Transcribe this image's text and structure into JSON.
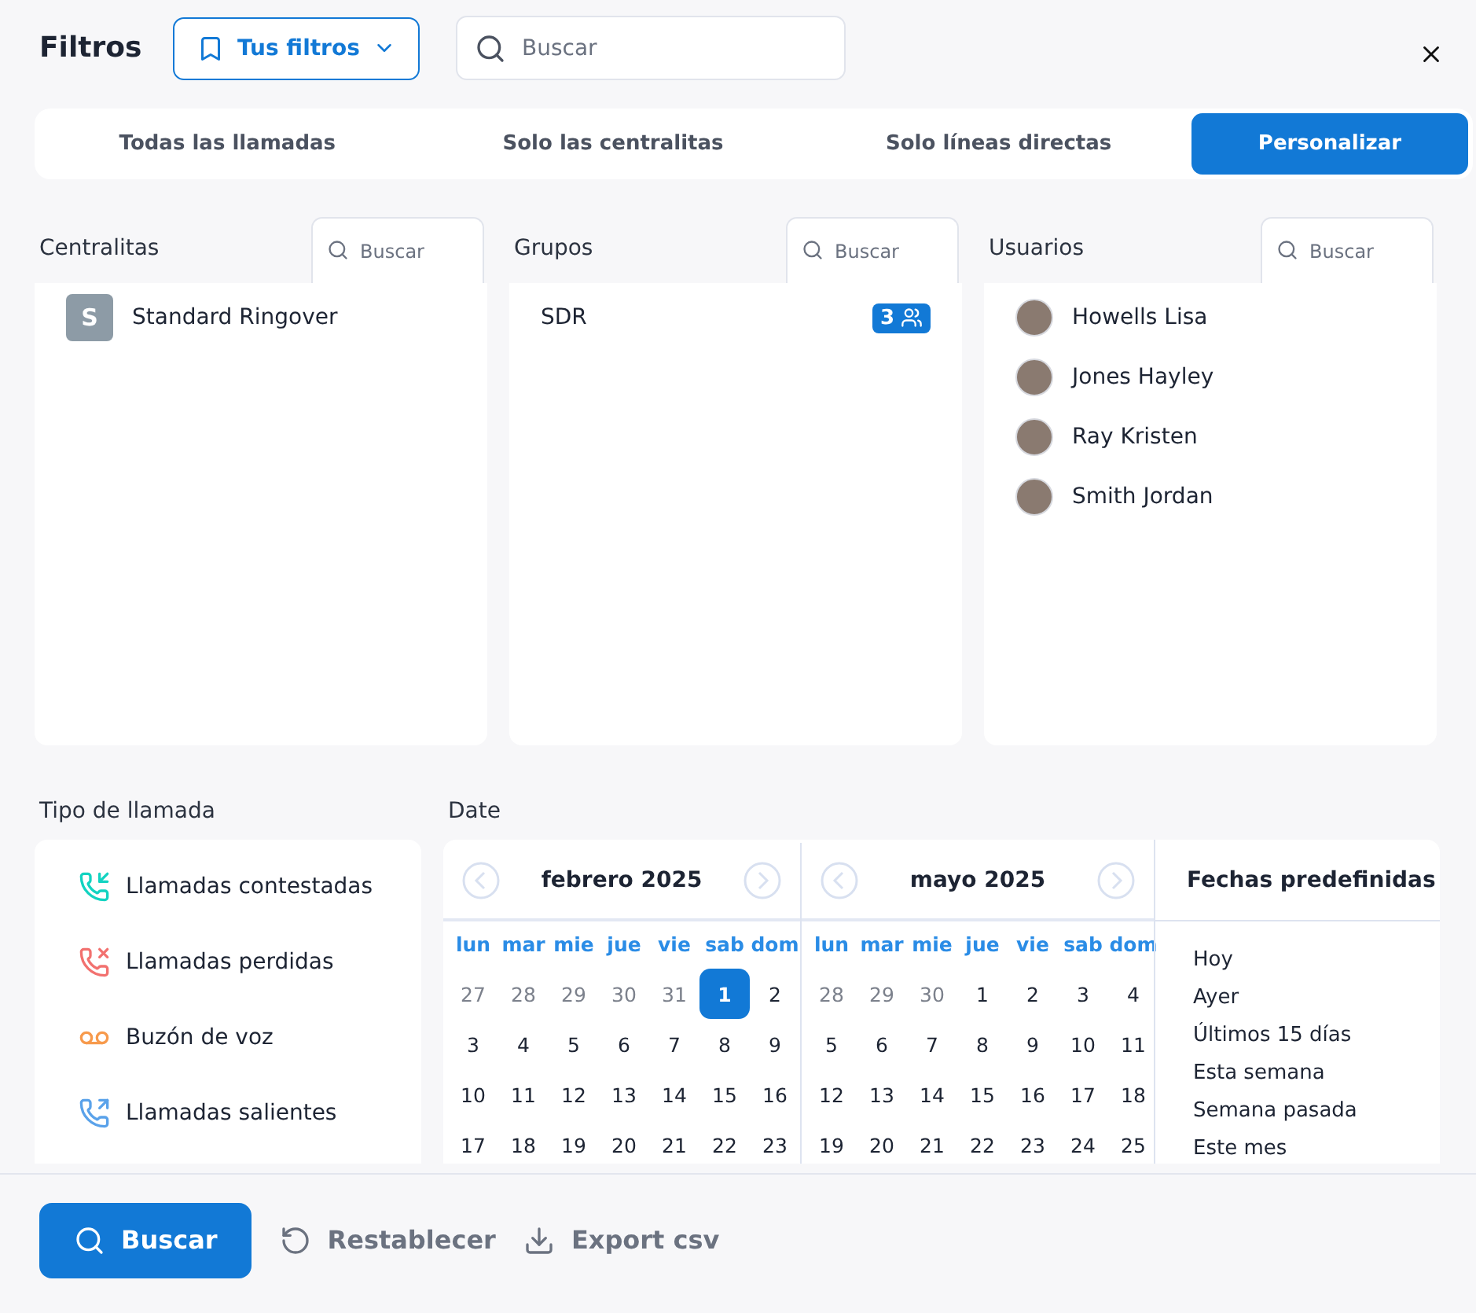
{
  "header": {
    "title": "Filtros",
    "saved_filters_button": "Tus filtros",
    "search": {
      "placeholder": "Buscar"
    }
  },
  "tabs": [
    {
      "label": "Todas las llamadas",
      "selected": false
    },
    {
      "label": "Solo las centralitas",
      "selected": false
    },
    {
      "label": "Solo líneas directas",
      "selected": false
    },
    {
      "label": "Personalizar",
      "selected": true
    }
  ],
  "columns": [
    {
      "title": "Centralitas",
      "search_placeholder": "Buscar",
      "items": [
        {
          "kind": "switchboard",
          "initial": "S",
          "name": "Standard Ringover"
        }
      ]
    },
    {
      "title": "Grupos",
      "search_placeholder": "Buscar",
      "items": [
        {
          "kind": "group",
          "name": "SDR",
          "count": "3"
        }
      ]
    },
    {
      "title": "Usuarios",
      "search_placeholder": "Buscar",
      "items": [
        {
          "kind": "user",
          "name": "Howells Lisa"
        },
        {
          "kind": "user",
          "name": "Jones Hayley"
        },
        {
          "kind": "user",
          "name": "Ray Kristen"
        },
        {
          "kind": "user",
          "name": "Smith Jordan"
        }
      ]
    }
  ],
  "call_types": {
    "title": "Tipo de llamada",
    "items": [
      {
        "kind": "answered",
        "label": "Llamadas contestadas",
        "color": "#12d3c1"
      },
      {
        "kind": "missed",
        "label": "Llamadas perdidas",
        "color": "#f2716f"
      },
      {
        "kind": "voicemail",
        "label": "Buzón de voz",
        "color": "#f79a4c"
      },
      {
        "kind": "outgoing",
        "label": "Llamadas salientes",
        "color": "#5aa2ea"
      }
    ]
  },
  "date": {
    "title": "Date",
    "months": [
      {
        "title": "febrero 2025",
        "weekdays": [
          "lun",
          "mar",
          "mie",
          "jue",
          "vie",
          "sab",
          "dom"
        ],
        "weeks": [
          [
            {
              "day": "27",
              "outside": true,
              "selected": false
            },
            {
              "day": "28",
              "outside": true,
              "selected": false
            },
            {
              "day": "29",
              "outside": true,
              "selected": false
            },
            {
              "day": "30",
              "outside": true,
              "selected": false
            },
            {
              "day": "31",
              "outside": true,
              "selected": false
            },
            {
              "day": "1",
              "outside": false,
              "selected": true
            },
            {
              "day": "2",
              "outside": false,
              "selected": false
            }
          ],
          [
            {
              "day": "3",
              "outside": false,
              "selected": false
            },
            {
              "day": "4",
              "outside": false,
              "selected": false
            },
            {
              "day": "5",
              "outside": false,
              "selected": false
            },
            {
              "day": "6",
              "outside": false,
              "selected": false
            },
            {
              "day": "7",
              "outside": false,
              "selected": false
            },
            {
              "day": "8",
              "outside": false,
              "selected": false
            },
            {
              "day": "9",
              "outside": false,
              "selected": false
            }
          ],
          [
            {
              "day": "10",
              "outside": false,
              "selected": false
            },
            {
              "day": "11",
              "outside": false,
              "selected": false
            },
            {
              "day": "12",
              "outside": false,
              "selected": false
            },
            {
              "day": "13",
              "outside": false,
              "selected": false
            },
            {
              "day": "14",
              "outside": false,
              "selected": false
            },
            {
              "day": "15",
              "outside": false,
              "selected": false
            },
            {
              "day": "16",
              "outside": false,
              "selected": false
            }
          ],
          [
            {
              "day": "17",
              "outside": false,
              "selected": false
            },
            {
              "day": "18",
              "outside": false,
              "selected": false
            },
            {
              "day": "19",
              "outside": false,
              "selected": false
            },
            {
              "day": "20",
              "outside": false,
              "selected": false
            },
            {
              "day": "21",
              "outside": false,
              "selected": false
            },
            {
              "day": "22",
              "outside": false,
              "selected": false
            },
            {
              "day": "23",
              "outside": false,
              "selected": false
            }
          ]
        ]
      },
      {
        "title": "mayo 2025",
        "weekdays": [
          "lun",
          "mar",
          "mie",
          "jue",
          "vie",
          "sab",
          "dom"
        ],
        "weeks": [
          [
            {
              "day": "28",
              "outside": true,
              "selected": false
            },
            {
              "day": "29",
              "outside": true,
              "selected": false
            },
            {
              "day": "30",
              "outside": true,
              "selected": false
            },
            {
              "day": "1",
              "outside": false,
              "selected": false
            },
            {
              "day": "2",
              "outside": false,
              "selected": false
            },
            {
              "day": "3",
              "outside": false,
              "selected": false
            },
            {
              "day": "4",
              "outside": false,
              "selected": false
            }
          ],
          [
            {
              "day": "5",
              "outside": false,
              "selected": false
            },
            {
              "day": "6",
              "outside": false,
              "selected": false
            },
            {
              "day": "7",
              "outside": false,
              "selected": false
            },
            {
              "day": "8",
              "outside": false,
              "selected": false
            },
            {
              "day": "9",
              "outside": false,
              "selected": false
            },
            {
              "day": "10",
              "outside": false,
              "selected": false
            },
            {
              "day": "11",
              "outside": false,
              "selected": false
            }
          ],
          [
            {
              "day": "12",
              "outside": false,
              "selected": false
            },
            {
              "day": "13",
              "outside": false,
              "selected": false
            },
            {
              "day": "14",
              "outside": false,
              "selected": false
            },
            {
              "day": "15",
              "outside": false,
              "selected": false
            },
            {
              "day": "16",
              "outside": false,
              "selected": false
            },
            {
              "day": "17",
              "outside": false,
              "selected": false
            },
            {
              "day": "18",
              "outside": false,
              "selected": false
            }
          ],
          [
            {
              "day": "19",
              "outside": false,
              "selected": false
            },
            {
              "day": "20",
              "outside": false,
              "selected": false
            },
            {
              "day": "21",
              "outside": false,
              "selected": false
            },
            {
              "day": "22",
              "outside": false,
              "selected": false
            },
            {
              "day": "23",
              "outside": false,
              "selected": false
            },
            {
              "day": "24",
              "outside": false,
              "selected": false
            },
            {
              "day": "25",
              "outside": false,
              "selected": false
            }
          ]
        ]
      }
    ],
    "presets": {
      "title": "Fechas predefinidas",
      "items": [
        "Hoy",
        "Ayer",
        "Últimos 15 días",
        "Esta semana",
        "Semana pasada",
        "Este mes"
      ]
    }
  },
  "footer": {
    "search_button": "Buscar",
    "reset_button": "Restablecer",
    "export_button": "Export csv"
  }
}
